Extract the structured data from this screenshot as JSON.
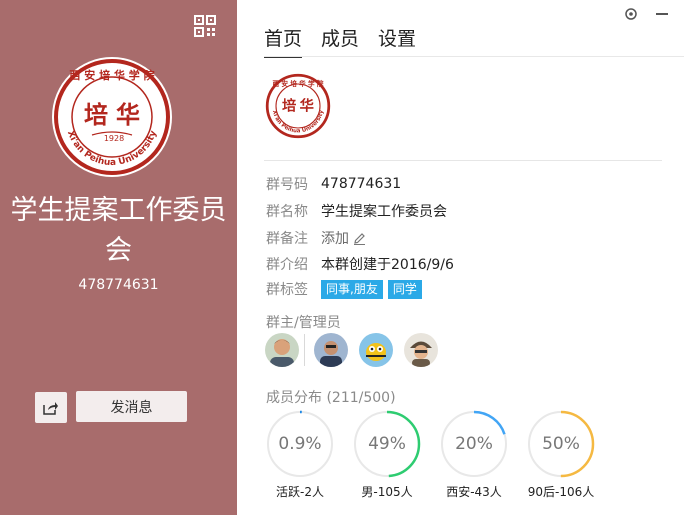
{
  "left_panel": {
    "group_name": "学生提案工作委员会",
    "group_id": "478774631",
    "send_message_label": "发消息"
  },
  "tabs": [
    {
      "label": "首页",
      "active": true
    },
    {
      "label": "成员",
      "active": false
    },
    {
      "label": "设置",
      "active": false
    }
  ],
  "info": {
    "group_number": {
      "label": "群号码",
      "value": "478774631"
    },
    "group_name": {
      "label": "群名称",
      "value": "学生提案工作委员会"
    },
    "group_note": {
      "label": "群备注",
      "value": "添加"
    },
    "group_intro": {
      "label": "群介绍",
      "value": "本群创建于2016/9/6"
    },
    "group_tags": {
      "label": "群标签",
      "tags": [
        "同事,朋友",
        "同学"
      ]
    }
  },
  "admins_title": "群主/管理员",
  "members_title": "成员分布",
  "members_count": "(211/500)",
  "stats": [
    {
      "text": "0.9%",
      "label": "活跃-2人",
      "fraction": 0.009,
      "color": "#1e88e5"
    },
    {
      "text": "49%",
      "label": "男-105人",
      "fraction": 0.49,
      "color": "#2ecc71"
    },
    {
      "text": "20%",
      "label": "西安-43人",
      "fraction": 0.2,
      "color": "#42a5f5"
    },
    {
      "text": "50%",
      "label": "90后-106人",
      "fraction": 0.5,
      "color": "#f5b942"
    }
  ],
  "colors": {
    "left_panel_bg": "#a86c6c",
    "tag_bg": "#2ba9e7",
    "logo_red": "#b3271e"
  },
  "icons": [
    "qr-code-icon",
    "settings-icon",
    "minimize-icon",
    "share-icon",
    "edit-icon"
  ],
  "logo": {
    "text_top": "西安培华学院",
    "text_ring": "Xi'an Peihua University",
    "year": "1928",
    "calligraphy": "培华"
  }
}
